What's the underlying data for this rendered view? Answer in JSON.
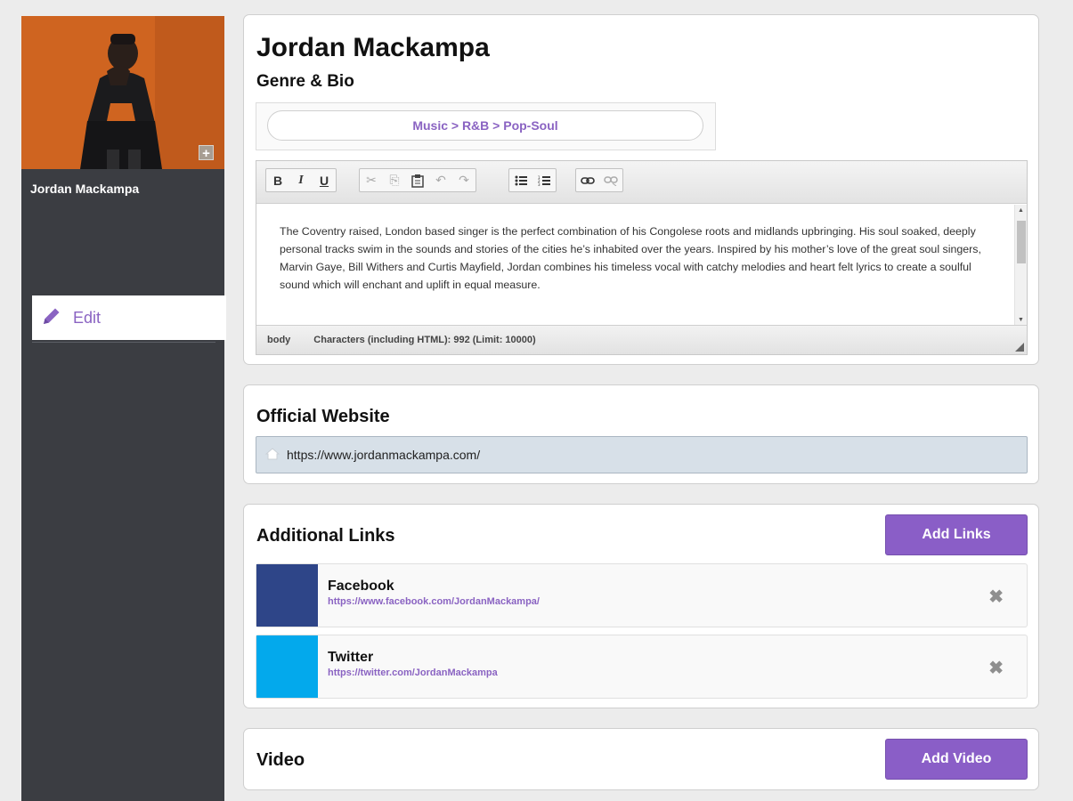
{
  "sidebar": {
    "artist_name": "Jordan Mackampa",
    "add_photo_label": "+",
    "edit_label": "Edit"
  },
  "profile": {
    "name": "Jordan Mackampa",
    "genre_bio_heading": "Genre & Bio",
    "genre_path": "Music > R&B > Pop-Soul"
  },
  "editor": {
    "toolbar": {
      "bold": "B",
      "italic": "I",
      "underline": "U",
      "cut": "✂",
      "copy": "⎘",
      "paste": "📋",
      "undo": "↶",
      "redo": "↷",
      "bullet_list": "☰",
      "numbered_list": "⒈",
      "link": "⛓",
      "unlink": "⛓"
    },
    "bio_text": "The Coventry raised, London based singer is the perfect combination of his Congolese roots and midlands upbringing. His soul soaked, deeply personal tracks swim in the sounds and stories of the cities he’s inhabited over the years. Inspired by his mother’s love of the great soul singers, Marvin Gaye, Bill Withers and Curtis Mayfield, Jordan combines his timeless vocal with catchy melodies and heart felt lyrics to create a soulful sound which will enchant and uplift in equal measure.",
    "status_path": "body",
    "status_count": "Characters (including HTML): 992 (Limit: 10000)"
  },
  "website": {
    "heading": "Official Website",
    "url": "https://www.jordanmackampa.com/"
  },
  "links": {
    "heading": "Additional Links",
    "add_button": "Add Links",
    "items": [
      {
        "title": "Facebook",
        "url": "https://www.facebook.com/JordanMackampa/",
        "color": "#2e4588"
      },
      {
        "title": "Twitter",
        "url": "https://twitter.com/JordanMackampa",
        "color": "#03a9ec"
      }
    ],
    "remove_glyph": "✖"
  },
  "video": {
    "heading": "Video",
    "add_button": "Add Video"
  },
  "colors": {
    "accent": "#8a5ec7",
    "sidebar": "#3b3d42"
  }
}
